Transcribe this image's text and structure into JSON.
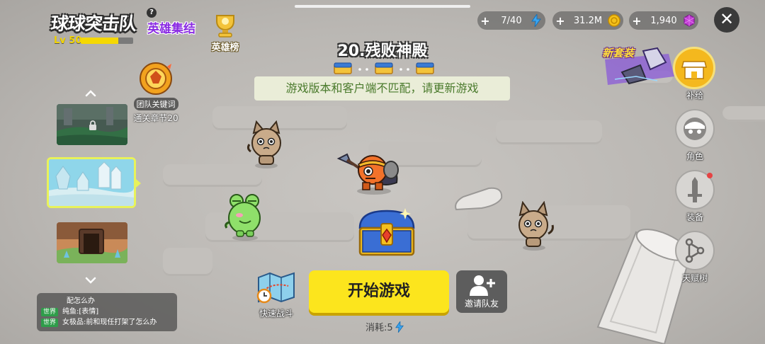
{
  "header": {
    "game_title": "球球突击队",
    "guild_name": "英雄集结",
    "help": "?",
    "level_label": "Lv 50",
    "level_progress": 0.72,
    "rank_label": "英雄榜"
  },
  "resources": [
    {
      "plus": "+",
      "value": "7/40",
      "icon": "energy-bolt-icon",
      "color": "#3aa6f2"
    },
    {
      "plus": "+",
      "value": "31.2M",
      "icon": "gold-coin-icon",
      "color": "#f4c11a"
    },
    {
      "plus": "+",
      "value": "1,940",
      "icon": "purple-gem-icon",
      "color": "#c23bd4"
    }
  ],
  "close": "✕",
  "stage": {
    "title": "20.残败神殿",
    "chests": 3,
    "notice": "游戏版本和客户端不匹配，请更新游戏"
  },
  "left_panel": {
    "team_keyword": "团队关键词",
    "clear_chapter": "通关章节20",
    "levels": [
      {
        "name": "forest-ruins",
        "locked": true,
        "selected": false
      },
      {
        "name": "ice-temple",
        "locked": false,
        "selected": true
      },
      {
        "name": "cave-gate",
        "locked": false,
        "selected": false
      }
    ]
  },
  "chat": {
    "lines": [
      {
        "channel": "",
        "text": "配怎么办"
      },
      {
        "channel": "世界",
        "text": "纯鱼:[表情]"
      },
      {
        "channel": "世界",
        "text": "女极品:前和现任打架了怎么办"
      }
    ]
  },
  "actions": {
    "quick_battle": "快速战斗",
    "start_game": "开始游戏",
    "cost_label": "消耗:5",
    "invite": "邀请队友"
  },
  "right_panel": {
    "new_outfit": "新套装",
    "supply": "补给",
    "role": "角色",
    "equipment": "装备",
    "talent_tree": "天赋树"
  }
}
